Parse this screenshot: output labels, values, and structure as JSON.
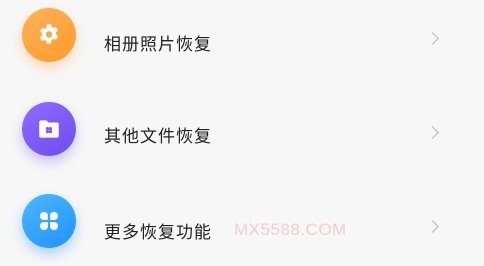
{
  "menu": {
    "items": [
      {
        "label": "相册照片恢复",
        "icon": "gear-icon",
        "color": "#ffa63f"
      },
      {
        "label": "其他文件恢复",
        "icon": "folder-icon",
        "color": "#7b5af5"
      },
      {
        "label": "更多恢复功能",
        "icon": "four-petal-icon",
        "color": "#2fa3ff"
      }
    ]
  },
  "watermark": "MX5588.COM"
}
